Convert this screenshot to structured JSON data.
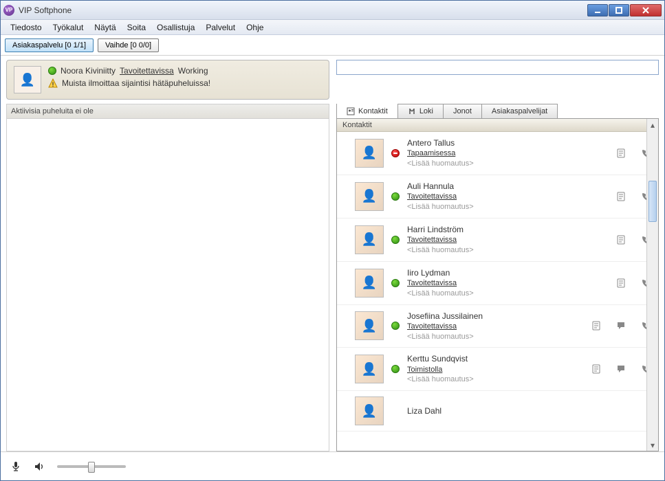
{
  "window": {
    "title": "VIP Softphone"
  },
  "menu": [
    "Tiedosto",
    "Työkalut",
    "Näytä",
    "Soita",
    "Osallistuja",
    "Palvelut",
    "Ohje"
  ],
  "queues": [
    {
      "label": "Asiakaspalvelu [0 1/1]",
      "active": true
    },
    {
      "label": "Vaihde [0 0/0]",
      "active": false
    }
  ],
  "me": {
    "name": "Noora Kiviniitty",
    "status": "Tavoitettavissa",
    "activity": "Working",
    "reminder": "Muista ilmoittaa sijaintisi hätäpuheluissa!"
  },
  "left": {
    "no_calls": "Aktiivisia puheluita ei ole"
  },
  "tabs": {
    "contacts": "Kontaktit",
    "log": "Loki",
    "queues": "Jonot",
    "agents": "Asiakaspalvelijat"
  },
  "contacts_section": "Kontaktit",
  "note_placeholder": "<Lisää huomautus>",
  "contacts": [
    {
      "name": "Antero Tallus",
      "status": "Tapaamisessa",
      "presence": "busy",
      "chat": false
    },
    {
      "name": "Auli Hannula",
      "status": "Tavoitettavissa",
      "presence": "available",
      "chat": false
    },
    {
      "name": "Harri Lindström",
      "status": "Tavoitettavissa",
      "presence": "available",
      "chat": false
    },
    {
      "name": "Iiro Lydman",
      "status": "Tavoitettavissa",
      "presence": "available",
      "chat": false
    },
    {
      "name": "Josefiina Jussilainen",
      "status": "Tavoitettavissa",
      "presence": "available",
      "chat": true
    },
    {
      "name": "Kerttu Sundqvist",
      "status": "Toimistolla",
      "presence": "available",
      "chat": true
    },
    {
      "name": "Liza Dahl",
      "status": "",
      "presence": "",
      "chat": false
    }
  ]
}
